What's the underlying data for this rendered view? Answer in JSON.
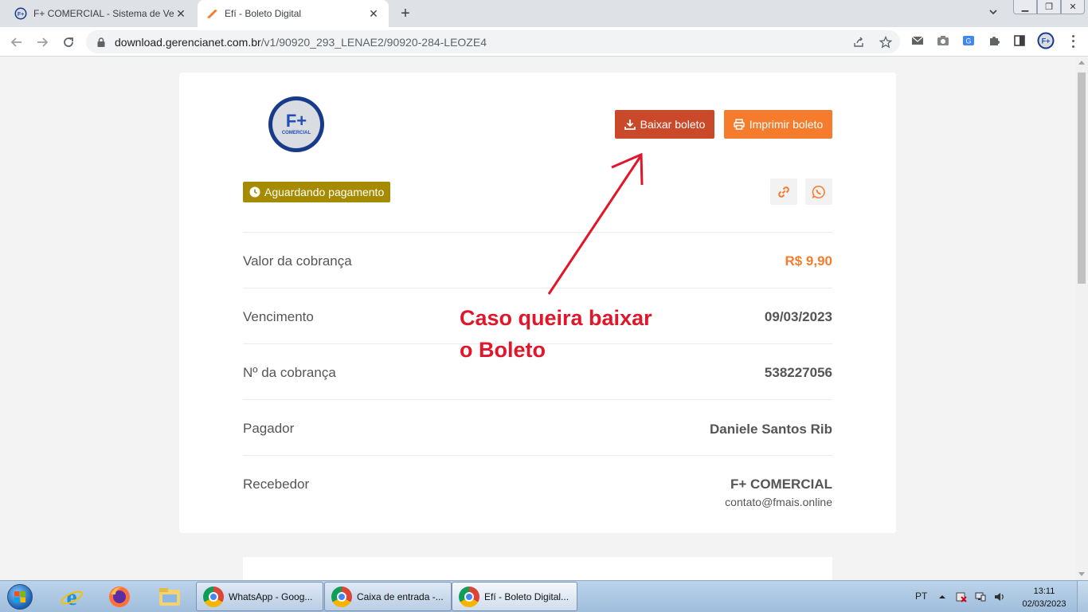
{
  "browser": {
    "tabs": [
      {
        "title": "F+ COMERCIAL - Sistema de Ven",
        "favicon": "fplus-icon",
        "active": false
      },
      {
        "title": "Efí - Boleto Digital",
        "favicon": "efi-icon",
        "active": true
      }
    ],
    "url_host": "download.gerencianet.com.br",
    "url_path": "/v1/90920_293_LENAE2/90920-284-LEOZE4"
  },
  "page": {
    "logo": {
      "mark": "F+",
      "word": "COMERCIAL"
    },
    "download_label": "Baixar boleto",
    "print_label": "Imprimir boleto",
    "status": "Aguardando pagamento",
    "rows": [
      {
        "label": "Valor da cobrança",
        "value": "R$ 9,90"
      },
      {
        "label": "Vencimento",
        "value": "09/03/2023"
      },
      {
        "label": "Nº da cobrança",
        "value": "538227056"
      },
      {
        "label": "Pagador",
        "value": "Daniele Santos Rib"
      },
      {
        "label": "Recebedor",
        "value": "F+ COMERCIAL",
        "sub": "contato@fmais.online"
      }
    ],
    "annotation": "Caso queira baixar\no Boleto",
    "accent_color": "#f57c2d",
    "download_color": "#c9492a",
    "status_color": "#a68b00",
    "annotation_color": "#e0162b"
  },
  "taskbar": {
    "tasks": [
      {
        "label": "WhatsApp - Goog..."
      },
      {
        "label": "Caixa de entrada -..."
      },
      {
        "label": "Efí - Boleto Digital..."
      }
    ],
    "lang": "PT",
    "time": "13:11",
    "date": "02/03/2023"
  }
}
